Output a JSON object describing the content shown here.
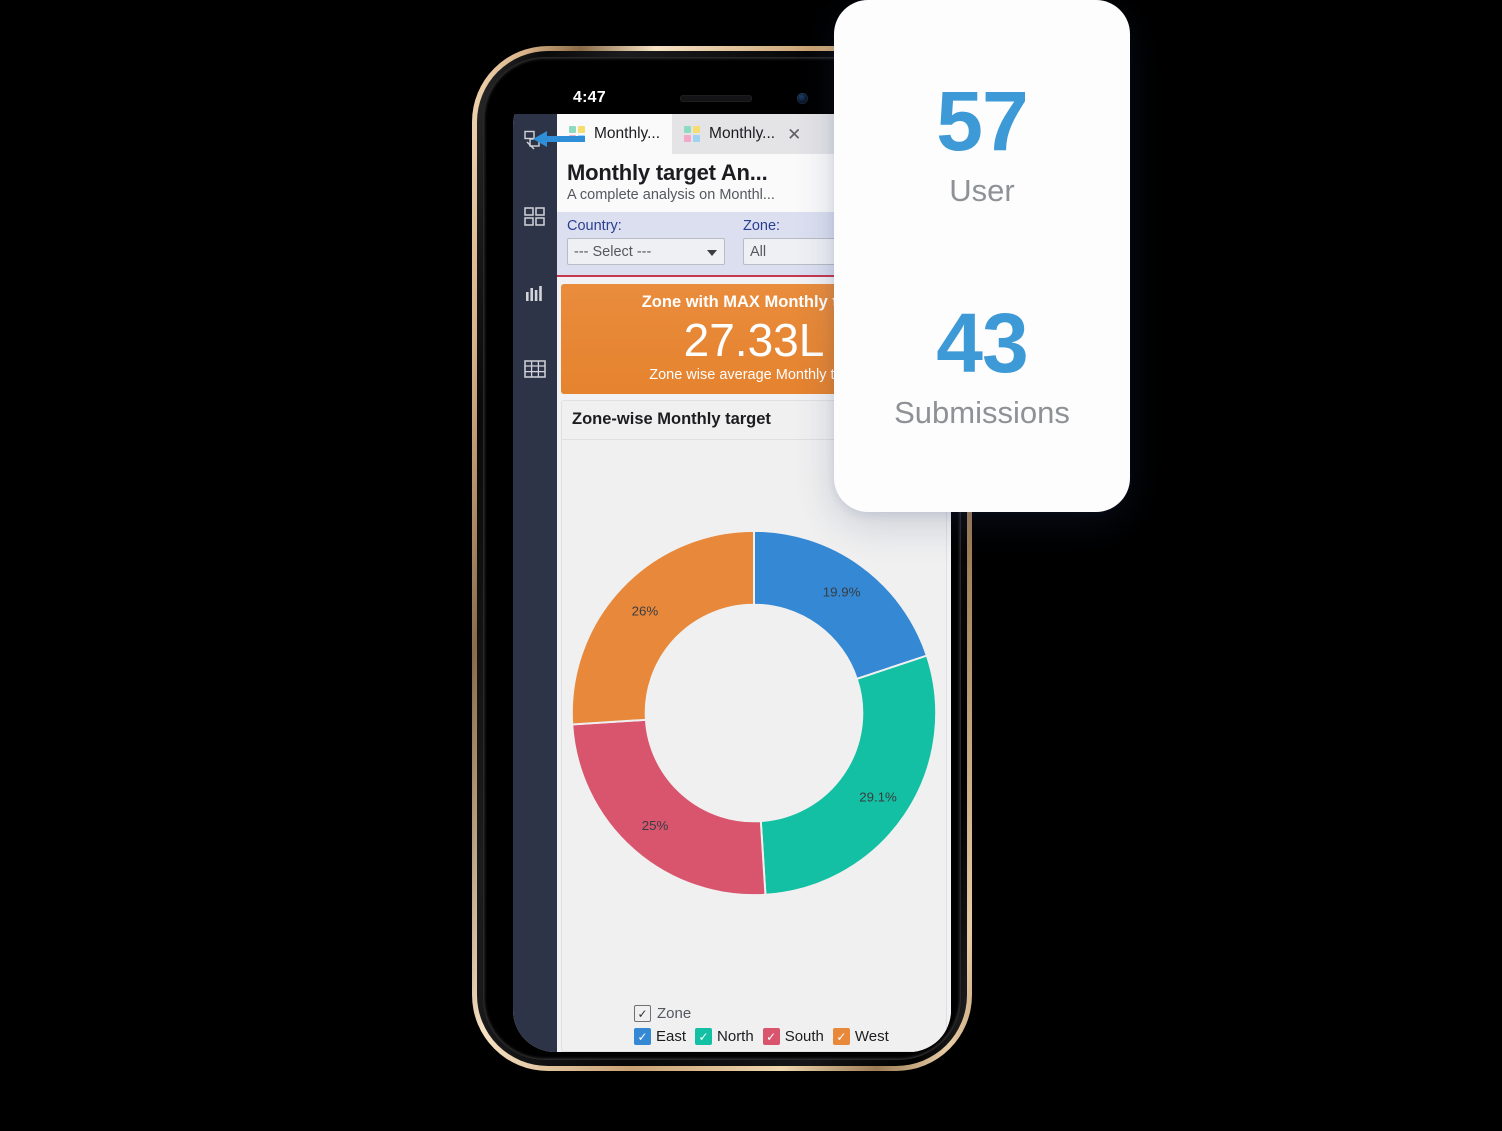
{
  "status_bar": {
    "time": "4:47"
  },
  "rail": {
    "items": [
      {
        "name": "reports-icon",
        "label": "Reports"
      },
      {
        "name": "dashboard-icon",
        "label": "Dashboards"
      },
      {
        "name": "chart-icon",
        "label": "Charts"
      },
      {
        "name": "table-icon",
        "label": "Tables"
      }
    ]
  },
  "tabs": [
    {
      "label": "Monthly...",
      "active": false,
      "closable": false
    },
    {
      "label": "Monthly...",
      "active": true,
      "closable": true,
      "close_glyph": "✕"
    }
  ],
  "report": {
    "title": "Monthly target An...",
    "subtitle": "A complete analysis on Monthl..."
  },
  "filters": [
    {
      "label": "Country:",
      "value": "--- Select ---",
      "type": "dropdown"
    },
    {
      "label": "Zone:",
      "value": "All",
      "type": "dropdown"
    }
  ],
  "kpi_card": {
    "title": "Zone with MAX Monthly tar...",
    "value": "27.33L",
    "footer": "Zone wise average Monthly tar...",
    "color": "#e8883a"
  },
  "chart_card": {
    "title": "Zone-wise Monthly target"
  },
  "legend": {
    "header_label": "Zone",
    "header_check": "✓",
    "items": [
      {
        "label": "East",
        "color": "#3488d4",
        "check": "✓"
      },
      {
        "label": "North",
        "color": "#13c0a3",
        "check": "✓"
      },
      {
        "label": "South",
        "color": "#d9556e",
        "check": "✓"
      },
      {
        "label": "West",
        "color": "#e8883a",
        "check": "✓"
      }
    ]
  },
  "chart_data": {
    "type": "pie",
    "title": "Zone-wise Monthly target",
    "donut": true,
    "categories": [
      "East",
      "North",
      "South",
      "West"
    ],
    "values": [
      19.9,
      29.1,
      25.0,
      26.0
    ],
    "labels": [
      "19.9%",
      "29.1%",
      "25%",
      "26%"
    ],
    "colors": [
      "#3488d4",
      "#13c0a3",
      "#d9556e",
      "#e8883a"
    ],
    "legend_position": "bottom",
    "start_angle_deg": -90,
    "units": "percent"
  },
  "floating_card": {
    "blocks": [
      {
        "number": "57",
        "label": "User"
      },
      {
        "number": "43",
        "label": "Submissions"
      }
    ],
    "number_color": "#3d9ad6"
  }
}
